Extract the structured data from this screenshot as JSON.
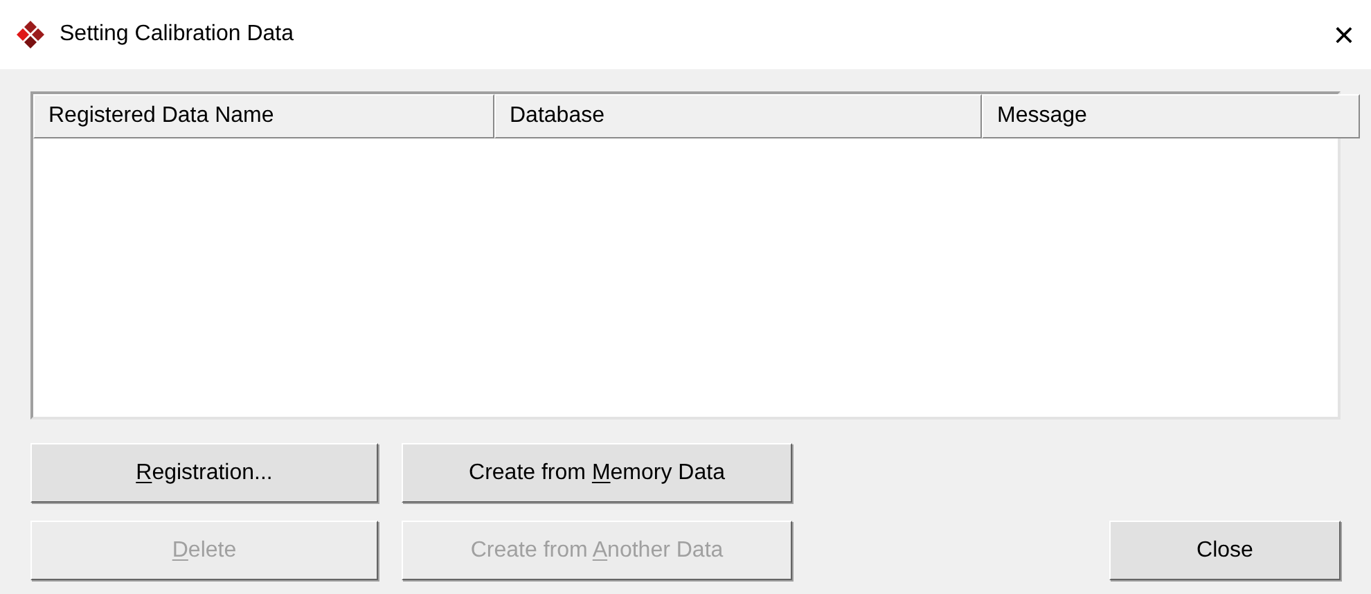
{
  "window": {
    "title": "Setting Calibration Data",
    "close_glyph": "×"
  },
  "table": {
    "columns": [
      "Registered Data Name",
      "Database",
      "Message"
    ]
  },
  "buttons": [
    {
      "key": "R",
      "post": "egistration...",
      "disabled": false
    },
    {
      "pre": "Create from ",
      "key": "M",
      "post": "emory Data",
      "disabled": false
    },
    {
      "key": "D",
      "post": "elete",
      "disabled": true
    },
    {
      "pre": "Create from ",
      "key": "A",
      "post": "nother Data",
      "disabled": true
    }
  ],
  "close_button": {
    "label": "Close",
    "disabled": false
  }
}
